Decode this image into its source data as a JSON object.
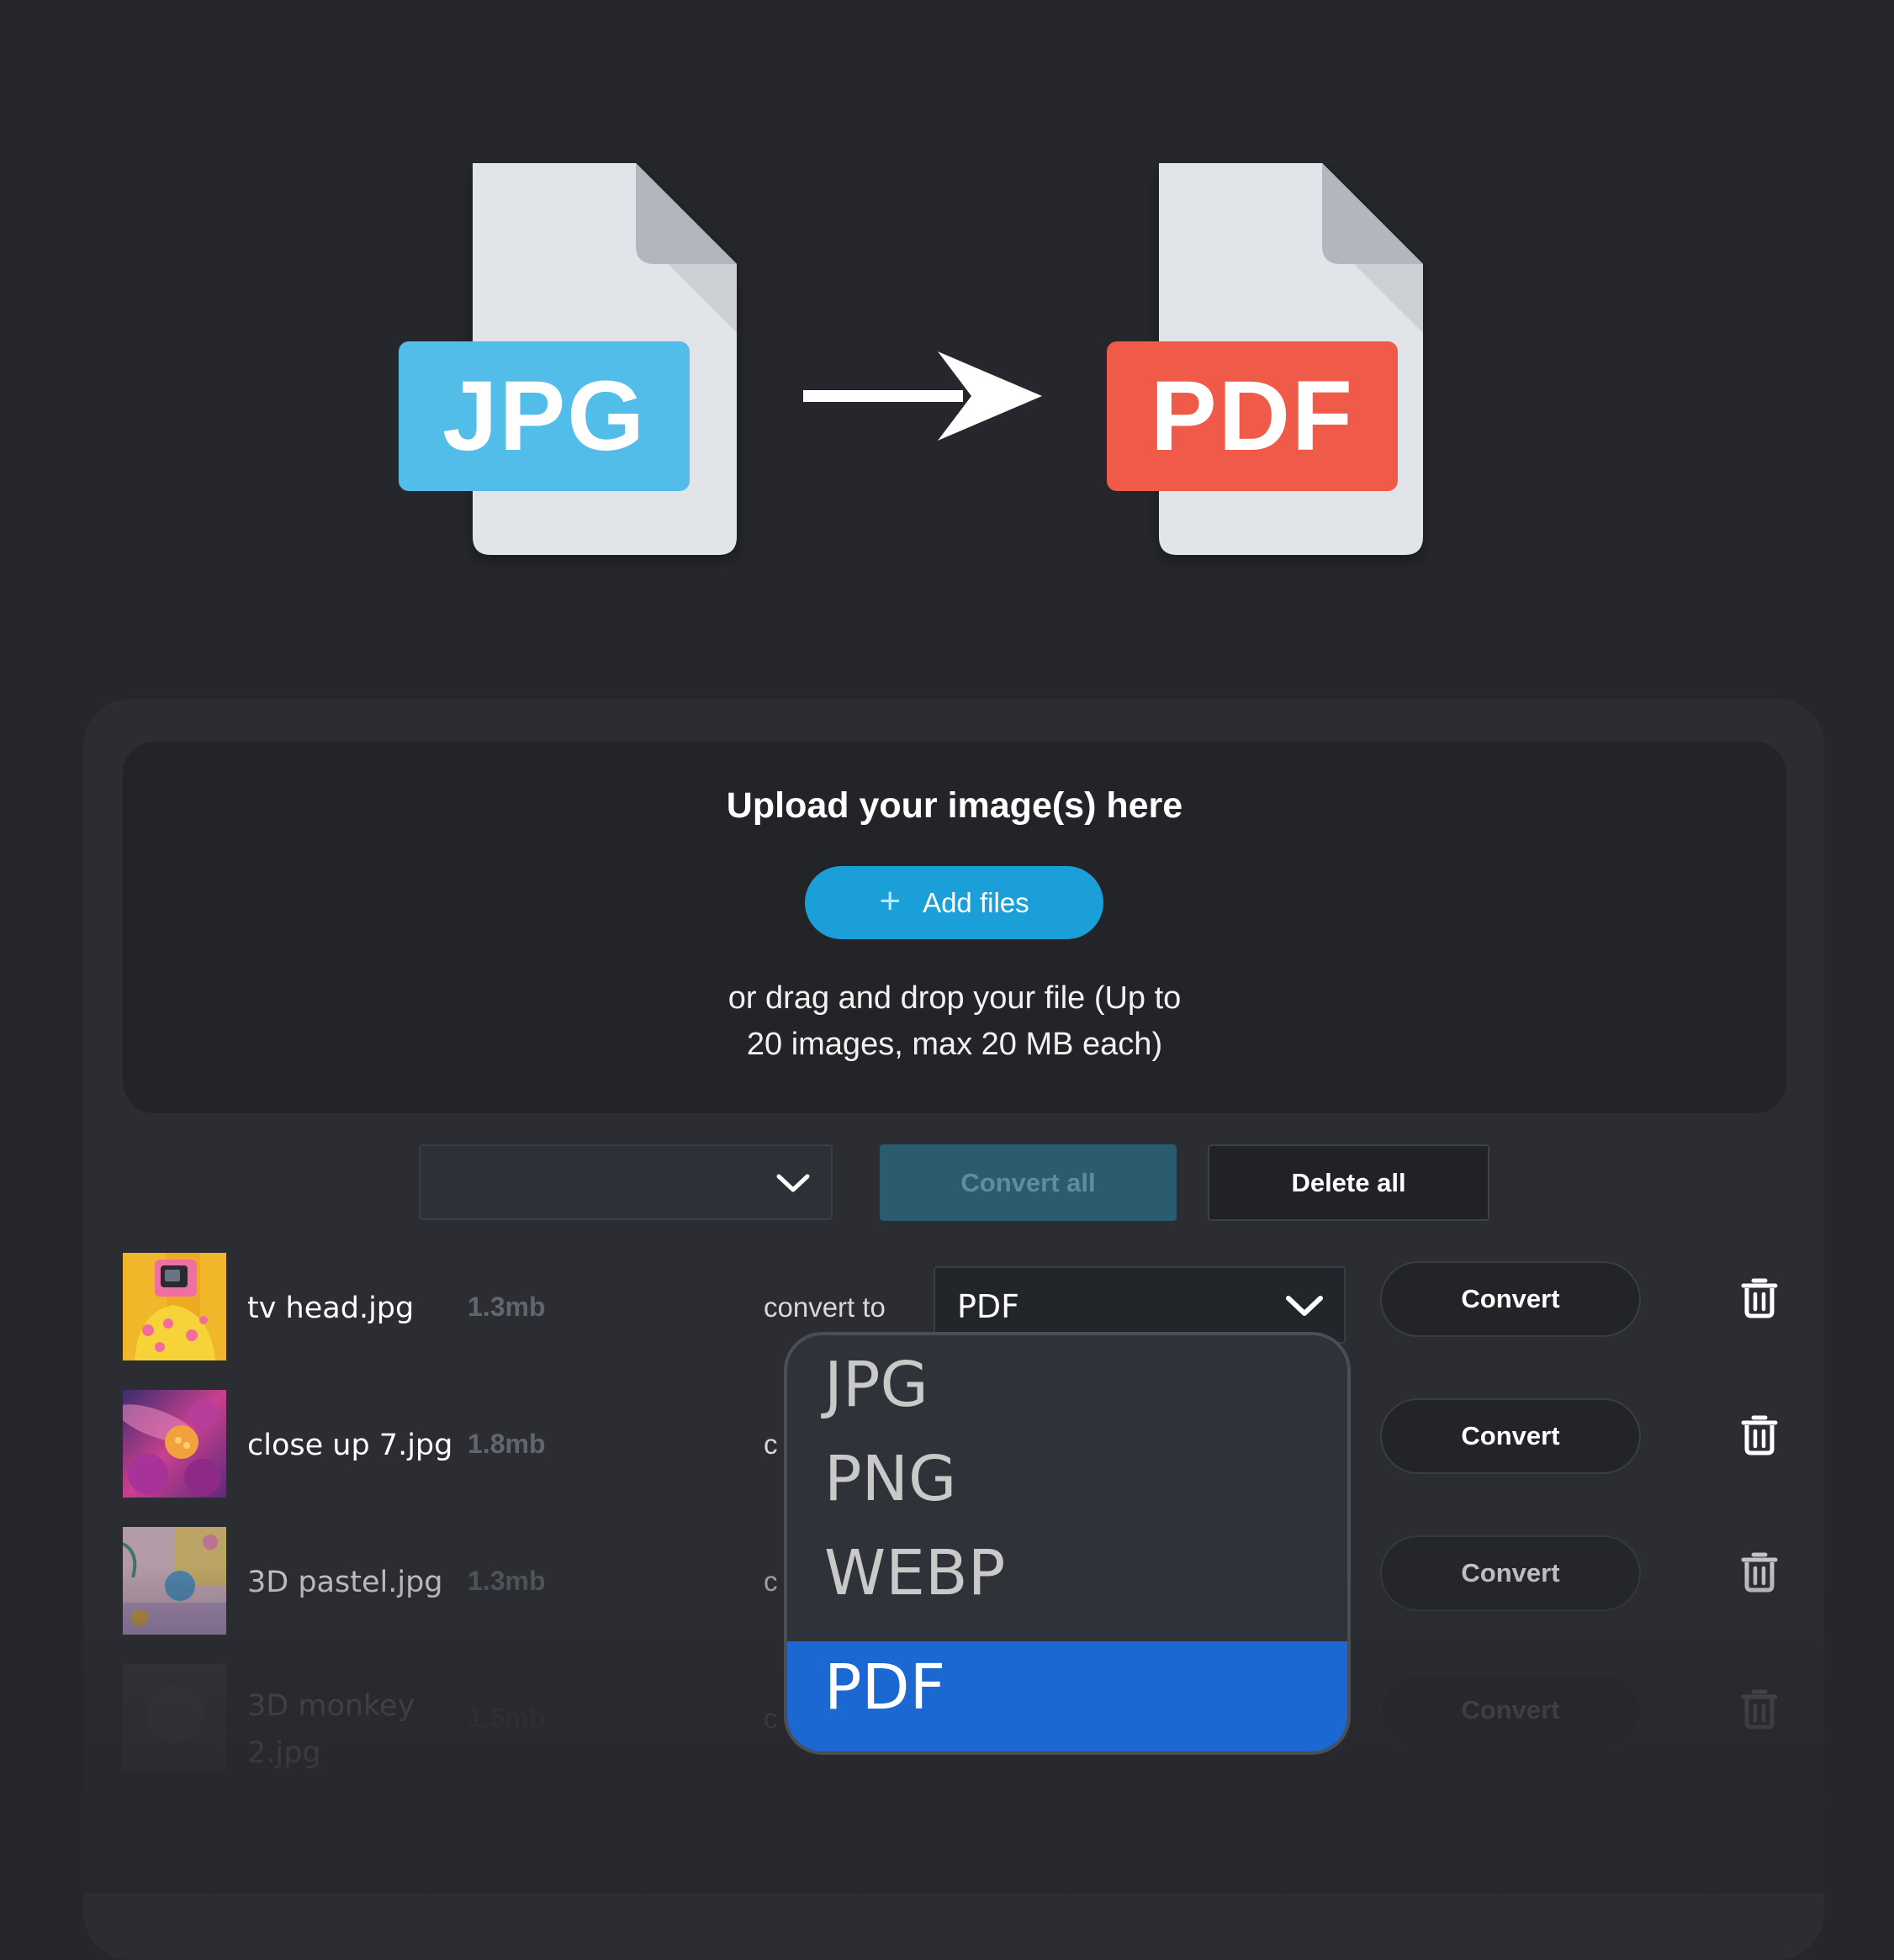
{
  "hero": {
    "source_format": "JPG",
    "target_format": "PDF",
    "source_color": "#52bde8",
    "target_color": "#f05a48",
    "arrow_icon": "right-arrow-icon"
  },
  "upload": {
    "title": "Upload your image(s) here",
    "add_files_label": "Add files",
    "add_icon": "plus-icon",
    "hint_line1": "or drag and drop your file (Up to",
    "hint_line2": "20 images, max 20 MB each)"
  },
  "bulk": {
    "format_value": "",
    "convert_all_label": "Convert all",
    "delete_all_label": "Delete all"
  },
  "files": [
    {
      "name": "tv head.jpg",
      "size": "1.3mb",
      "convert_to_label": "convert to",
      "selected_format": "PDF",
      "convert_label": "Convert"
    },
    {
      "name": "close up 7.jpg",
      "size": "1.8mb",
      "convert_to_label": "c",
      "convert_label": "Convert"
    },
    {
      "name": "3D pastel.jpg",
      "size": "1.3mb",
      "convert_to_label": "c",
      "convert_label": "Convert"
    },
    {
      "name": "3D monkey 2.jpg",
      "name_line1": "3D monkey",
      "name_line2": "2.jpg",
      "size": "1.5mb",
      "convert_to_label": "c",
      "convert_label": "Convert"
    }
  ],
  "dropdown": {
    "options": [
      "JPG",
      "PNG",
      "WEBP",
      "PDF"
    ],
    "selected": "PDF",
    "highlight_color": "#1b68d2"
  },
  "colors": {
    "background": "#25272c",
    "panel": "#2b2d32",
    "accent": "#1a9fd8"
  }
}
